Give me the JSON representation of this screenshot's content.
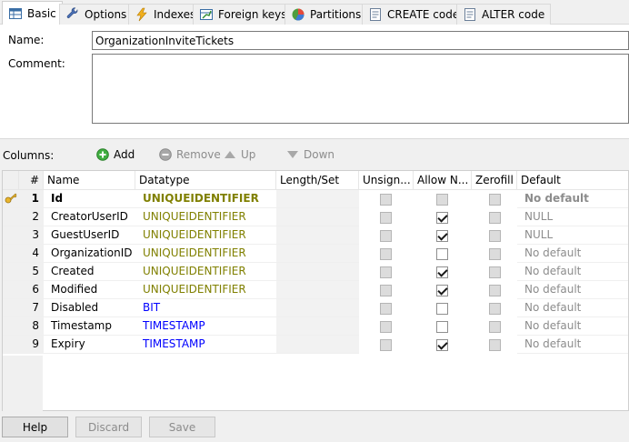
{
  "tabs": [
    {
      "label": "Basic",
      "icon": "table-icon",
      "active": true
    },
    {
      "label": "Options",
      "icon": "wrench-icon"
    },
    {
      "label": "Indexes",
      "icon": "lightning-icon"
    },
    {
      "label": "Foreign keys",
      "icon": "foreign-key-icon"
    },
    {
      "label": "Partitions",
      "icon": "pie-chart-icon"
    },
    {
      "label": "CREATE code",
      "icon": "code-icon"
    },
    {
      "label": "ALTER code",
      "icon": "code-icon"
    }
  ],
  "basic": {
    "name_label": "Name:",
    "name_value": "OrganizationInviteTickets",
    "comment_label": "Comment:",
    "comment_value": ""
  },
  "columns_toolbar": {
    "label": "Columns:",
    "add": "Add",
    "remove": "Remove",
    "up": "Up",
    "down": "Down"
  },
  "grid": {
    "headers": [
      "#",
      "Name",
      "Datatype",
      "Length/Set",
      "Unsign...",
      "Allow N...",
      "Zerofill",
      "Default"
    ],
    "rows": [
      {
        "num": "1",
        "name": "Id",
        "datatype": "UNIQUEIDENTIFIER",
        "dtype_color": "uid",
        "allow_null": false,
        "default": "No default",
        "primary": true
      },
      {
        "num": "2",
        "name": "CreatorUserID",
        "datatype": "UNIQUEIDENTIFIER",
        "dtype_color": "uid",
        "allow_null": true,
        "default": "NULL"
      },
      {
        "num": "3",
        "name": "GuestUserID",
        "datatype": "UNIQUEIDENTIFIER",
        "dtype_color": "uid",
        "allow_null": true,
        "default": "NULL"
      },
      {
        "num": "4",
        "name": "OrganizationID",
        "datatype": "UNIQUEIDENTIFIER",
        "dtype_color": "uid",
        "allow_null": false,
        "default": "No default"
      },
      {
        "num": "5",
        "name": "Created",
        "datatype": "UNIQUEIDENTIFIER",
        "dtype_color": "uid",
        "allow_null": true,
        "default": "No default"
      },
      {
        "num": "6",
        "name": "Modified",
        "datatype": "UNIQUEIDENTIFIER",
        "dtype_color": "uid",
        "allow_null": true,
        "default": "No default"
      },
      {
        "num": "7",
        "name": "Disabled",
        "datatype": "BIT",
        "dtype_color": "blue",
        "allow_null": false,
        "default": "No default"
      },
      {
        "num": "8",
        "name": "Timestamp",
        "datatype": "TIMESTAMP",
        "dtype_color": "blue",
        "allow_null": false,
        "default": "No default"
      },
      {
        "num": "9",
        "name": "Expiry",
        "datatype": "TIMESTAMP",
        "dtype_color": "blue",
        "allow_null": true,
        "default": "No default"
      }
    ]
  },
  "buttons": {
    "help": "Help",
    "discard": "Discard",
    "save": "Save"
  },
  "colors": {
    "uid": "#808000",
    "blue": "#0000ff",
    "accent": "#0078d7"
  }
}
